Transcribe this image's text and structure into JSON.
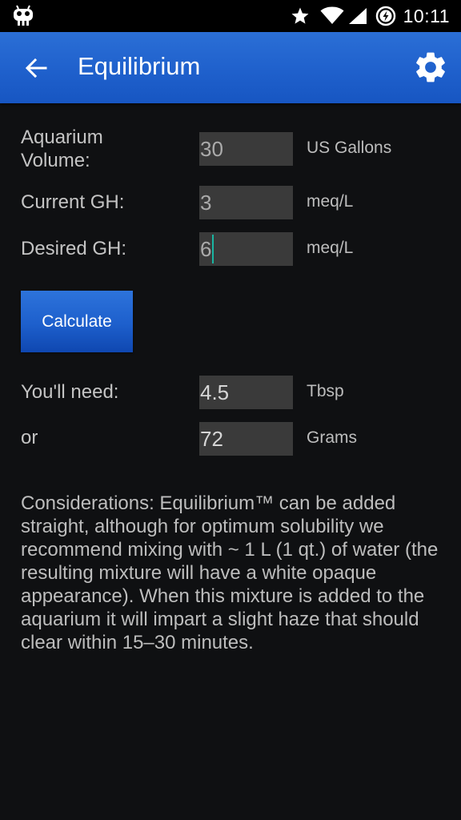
{
  "status_bar": {
    "time": "10:11",
    "icons": [
      "android-icon",
      "star-icon",
      "wifi-icon",
      "signal-icon",
      "battery-charging-icon"
    ]
  },
  "app_bar": {
    "title": "Equilibrium",
    "back_icon": "arrow-back-icon",
    "settings_icon": "gear-icon"
  },
  "form": {
    "volume": {
      "label": "Aquarium Volume:",
      "value": "30",
      "unit": "US Gallons"
    },
    "current_gh": {
      "label": "Current GH:",
      "value": "3",
      "unit": "meq/L"
    },
    "desired_gh": {
      "label": "Desired GH:",
      "value": "6",
      "unit": "meq/L"
    },
    "calculate_label": "Calculate"
  },
  "results": {
    "need": {
      "label": "You'll need:",
      "value": "4.5",
      "unit": "Tbsp"
    },
    "or": {
      "label": "or",
      "value": "72",
      "unit": "Grams"
    }
  },
  "considerations": "Considerations: Equilibrium™ can be added straight, although for optimum solubility we recommend mixing with ~ 1 L (1 qt.) of water (the resulting mixture will have a white opaque appearance). When this mixture is added to the aquarium it will impart a slight haze that should clear within 15–30 minutes.",
  "colors": {
    "background": "#0f1012",
    "app_bar": "#1e5fcb",
    "button": "#1d5fcc",
    "field": "#3a3a3a",
    "cursor": "#19b5a2"
  }
}
